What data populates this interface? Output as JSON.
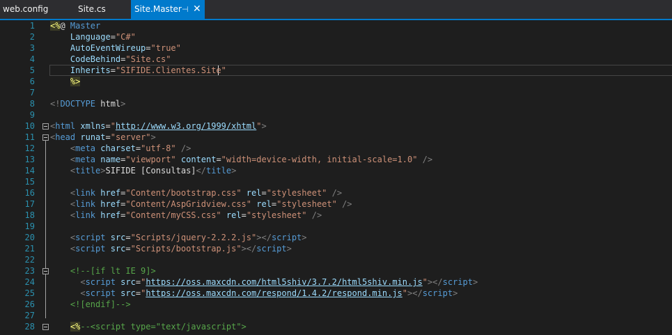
{
  "tabs": [
    {
      "label": "web.config"
    },
    {
      "label": "Site.cs"
    },
    {
      "label": "Site.Master",
      "pin": "⊣",
      "close": "✕"
    }
  ],
  "lines": [
    {
      "n": "1",
      "tokens": [
        {
          "t": "<%",
          "c": "dl"
        },
        {
          "t": "@ ",
          "c": "tx"
        },
        {
          "t": "Master",
          "c": "mt"
        }
      ]
    },
    {
      "n": "2",
      "tokens": [
        {
          "t": "    Language",
          "c": "at"
        },
        {
          "t": "=",
          "c": "tx"
        },
        {
          "t": "\"C#\"",
          "c": "sv"
        }
      ]
    },
    {
      "n": "3",
      "tokens": [
        {
          "t": "    AutoEventWireup",
          "c": "at"
        },
        {
          "t": "=",
          "c": "tx"
        },
        {
          "t": "\"true\"",
          "c": "sv"
        }
      ]
    },
    {
      "n": "4",
      "tokens": [
        {
          "t": "    CodeBehind",
          "c": "at"
        },
        {
          "t": "=",
          "c": "tx"
        },
        {
          "t": "\"Site.cs\"",
          "c": "sv"
        }
      ]
    },
    {
      "n": "5",
      "tokens": [
        {
          "t": "    Inherits",
          "c": "at"
        },
        {
          "t": "=",
          "c": "tx"
        },
        {
          "t": "\"SIFIDE.Clientes.Site\"",
          "c": "sv"
        }
      ]
    },
    {
      "n": "6",
      "tokens": [
        {
          "t": "    ",
          "c": "tx"
        },
        {
          "t": "%>",
          "c": "dl"
        }
      ]
    },
    {
      "n": "7",
      "tokens": []
    },
    {
      "n": "8",
      "tokens": [
        {
          "t": "<!",
          "c": "bk"
        },
        {
          "t": "DOCTYPE",
          "c": "tg"
        },
        {
          "t": " html",
          "c": "tx"
        },
        {
          "t": ">",
          "c": "bk"
        }
      ]
    },
    {
      "n": "9",
      "tokens": []
    },
    {
      "n": "10",
      "tokens": [
        {
          "t": "<",
          "c": "bk"
        },
        {
          "t": "html",
          "c": "tg"
        },
        {
          "t": " xmlns",
          "c": "at"
        },
        {
          "t": "=",
          "c": "tx"
        },
        {
          "t": "\"",
          "c": "sv"
        },
        {
          "t": "http://www.w3.org/1999/xhtml",
          "c": "ln2"
        },
        {
          "t": "\"",
          "c": "sv"
        },
        {
          "t": ">",
          "c": "bk"
        }
      ]
    },
    {
      "n": "11",
      "tokens": [
        {
          "t": "<",
          "c": "bk"
        },
        {
          "t": "head",
          "c": "tg"
        },
        {
          "t": " runat",
          "c": "at"
        },
        {
          "t": "=",
          "c": "tx"
        },
        {
          "t": "\"server\"",
          "c": "sv"
        },
        {
          "t": ">",
          "c": "bk"
        }
      ]
    },
    {
      "n": "12",
      "tokens": [
        {
          "t": "    <",
          "c": "bk"
        },
        {
          "t": "meta",
          "c": "tg"
        },
        {
          "t": " charset",
          "c": "at"
        },
        {
          "t": "=",
          "c": "tx"
        },
        {
          "t": "\"utf-8\"",
          "c": "sv"
        },
        {
          "t": " />",
          "c": "bk"
        }
      ]
    },
    {
      "n": "13",
      "tokens": [
        {
          "t": "    <",
          "c": "bk"
        },
        {
          "t": "meta",
          "c": "tg"
        },
        {
          "t": " name",
          "c": "at"
        },
        {
          "t": "=",
          "c": "tx"
        },
        {
          "t": "\"viewport\"",
          "c": "sv"
        },
        {
          "t": " content",
          "c": "at"
        },
        {
          "t": "=",
          "c": "tx"
        },
        {
          "t": "\"width=device-width, initial-scale=1.0\"",
          "c": "sv"
        },
        {
          "t": " />",
          "c": "bk"
        }
      ]
    },
    {
      "n": "14",
      "tokens": [
        {
          "t": "    <",
          "c": "bk"
        },
        {
          "t": "title",
          "c": "tg"
        },
        {
          "t": ">",
          "c": "bk"
        },
        {
          "t": "SIFIDE [Consultas]",
          "c": "tx"
        },
        {
          "t": "</",
          "c": "bk"
        },
        {
          "t": "title",
          "c": "tg"
        },
        {
          "t": ">",
          "c": "bk"
        }
      ]
    },
    {
      "n": "15",
      "tokens": []
    },
    {
      "n": "16",
      "tokens": [
        {
          "t": "    <",
          "c": "bk"
        },
        {
          "t": "link",
          "c": "tg"
        },
        {
          "t": " href",
          "c": "at"
        },
        {
          "t": "=",
          "c": "tx"
        },
        {
          "t": "\"Content/bootstrap.css\"",
          "c": "sv"
        },
        {
          "t": " rel",
          "c": "at"
        },
        {
          "t": "=",
          "c": "tx"
        },
        {
          "t": "\"stylesheet\"",
          "c": "sv"
        },
        {
          "t": " />",
          "c": "bk"
        }
      ]
    },
    {
      "n": "17",
      "tokens": [
        {
          "t": "    <",
          "c": "bk"
        },
        {
          "t": "link",
          "c": "tg"
        },
        {
          "t": " href",
          "c": "at"
        },
        {
          "t": "=",
          "c": "tx"
        },
        {
          "t": "\"Content/AspGridview.css\"",
          "c": "sv"
        },
        {
          "t": " rel",
          "c": "at"
        },
        {
          "t": "=",
          "c": "tx"
        },
        {
          "t": "\"stylesheet\"",
          "c": "sv"
        },
        {
          "t": " />",
          "c": "bk"
        }
      ]
    },
    {
      "n": "18",
      "tokens": [
        {
          "t": "    <",
          "c": "bk"
        },
        {
          "t": "link",
          "c": "tg"
        },
        {
          "t": " href",
          "c": "at"
        },
        {
          "t": "=",
          "c": "tx"
        },
        {
          "t": "\"Content/myCSS.css\"",
          "c": "sv"
        },
        {
          "t": " rel",
          "c": "at"
        },
        {
          "t": "=",
          "c": "tx"
        },
        {
          "t": "\"stylesheet\"",
          "c": "sv"
        },
        {
          "t": " />",
          "c": "bk"
        }
      ]
    },
    {
      "n": "19",
      "tokens": []
    },
    {
      "n": "20",
      "tokens": [
        {
          "t": "    <",
          "c": "bk"
        },
        {
          "t": "script",
          "c": "tg"
        },
        {
          "t": " src",
          "c": "at"
        },
        {
          "t": "=",
          "c": "tx"
        },
        {
          "t": "\"Scripts/jquery-2.2.2.js\"",
          "c": "sv"
        },
        {
          "t": "></",
          "c": "bk"
        },
        {
          "t": "script",
          "c": "tg"
        },
        {
          "t": ">",
          "c": "bk"
        }
      ]
    },
    {
      "n": "21",
      "tokens": [
        {
          "t": "    <",
          "c": "bk"
        },
        {
          "t": "script",
          "c": "tg"
        },
        {
          "t": " src",
          "c": "at"
        },
        {
          "t": "=",
          "c": "tx"
        },
        {
          "t": "\"Scripts/bootstrap.js\"",
          "c": "sv"
        },
        {
          "t": "></",
          "c": "bk"
        },
        {
          "t": "script",
          "c": "tg"
        },
        {
          "t": ">",
          "c": "bk"
        }
      ]
    },
    {
      "n": "22",
      "tokens": []
    },
    {
      "n": "23",
      "tokens": [
        {
          "t": "    <!--[if lt IE 9]>",
          "c": "cm"
        }
      ]
    },
    {
      "n": "24",
      "tokens": [
        {
          "t": "      <",
          "c": "bk"
        },
        {
          "t": "script",
          "c": "tg"
        },
        {
          "t": " src",
          "c": "at"
        },
        {
          "t": "=",
          "c": "tx"
        },
        {
          "t": "\"",
          "c": "sv"
        },
        {
          "t": "https://oss.maxcdn.com/html5shiv/3.7.2/html5shiv.min.js",
          "c": "ln2"
        },
        {
          "t": "\"",
          "c": "sv"
        },
        {
          "t": "></",
          "c": "bk"
        },
        {
          "t": "script",
          "c": "tg"
        },
        {
          "t": ">",
          "c": "bk"
        }
      ]
    },
    {
      "n": "25",
      "tokens": [
        {
          "t": "      <",
          "c": "bk"
        },
        {
          "t": "script",
          "c": "tg"
        },
        {
          "t": " src",
          "c": "at"
        },
        {
          "t": "=",
          "c": "tx"
        },
        {
          "t": "\"",
          "c": "sv"
        },
        {
          "t": "https://oss.maxcdn.com/respond/1.4.2/respond.min.js",
          "c": "ln2"
        },
        {
          "t": "\"",
          "c": "sv"
        },
        {
          "t": "></",
          "c": "bk"
        },
        {
          "t": "script",
          "c": "tg"
        },
        {
          "t": ">",
          "c": "bk"
        }
      ]
    },
    {
      "n": "26",
      "tokens": [
        {
          "t": "    <![endif]-->",
          "c": "cm"
        }
      ]
    },
    {
      "n": "27",
      "tokens": []
    },
    {
      "n": "28",
      "tokens": [
        {
          "t": "    ",
          "c": "tx"
        },
        {
          "t": "<%",
          "c": "dl"
        },
        {
          "t": "--<script type=\"text/javascript\">",
          "c": "cm"
        }
      ]
    }
  ]
}
